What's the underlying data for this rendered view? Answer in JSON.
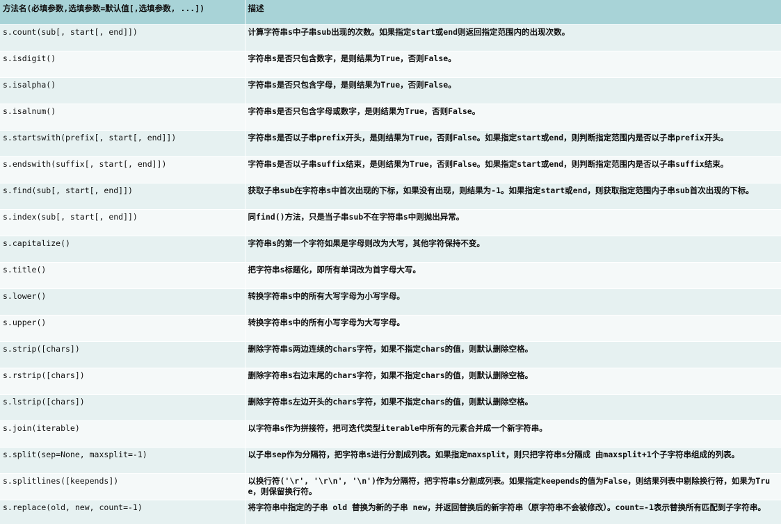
{
  "table": {
    "headers": {
      "method": "方法名(必填参数,选填参数=默认值[,选填参数, ...])",
      "description": "描述"
    },
    "rows": [
      {
        "method": "s.count(sub[, start[, end]])",
        "description": "计算字符串s中子串sub出现的次数。如果指定start或end则返回指定范围内的出现次数。"
      },
      {
        "method": "s.isdigit()",
        "description": "字符串s是否只包含数字，是则结果为True，否则False。"
      },
      {
        "method": "s.isalpha()",
        "description": "字符串s是否只包含字母，是则结果为True，否则False。"
      },
      {
        "method": "s.isalnum()",
        "description": "字符串s是否只包含字母或数字，是则结果为True，否则False。"
      },
      {
        "method": "s.startswith(prefix[, start[, end]])",
        "description": "字符串s是否以子串prefix开头，是则结果为True，否则False。如果指定start或end，则判断指定范围内是否以子串prefix开头。"
      },
      {
        "method": "s.endswith(suffix[, start[, end]])",
        "description": "字符串s是否以子串suffix结束，是则结果为True，否则False。如果指定start或end，则判断指定范围内是否以子串suffix结束。"
      },
      {
        "method": "s.find(sub[, start[, end]])",
        "description": "获取子串sub在字符串s中首次出现的下标，如果没有出现，则结果为-1。如果指定start或end，则获取指定范围内子串sub首次出现的下标。"
      },
      {
        "method": "s.index(sub[, start[, end]])",
        "description": "同find()方法，只是当子串sub不在字符串s中则抛出异常。"
      },
      {
        "method": "s.capitalize()",
        "description": "字符串s的第一个字符如果是字母则改为大写，其他字符保持不变。"
      },
      {
        "method": "s.title()",
        "description": "把字符串s标题化，即所有单词改为首字母大写。"
      },
      {
        "method": "s.lower()",
        "description": "转换字符串s中的所有大写字母为小写字母。"
      },
      {
        "method": "s.upper()",
        "description": "转换字符串s中的所有小写字母为大写字母。"
      },
      {
        "method": "s.strip([chars])",
        "description": "删除字符串s两边连续的chars字符，如果不指定chars的值，则默认删除空格。"
      },
      {
        "method": "s.rstrip([chars])",
        "description": "删除字符串s右边末尾的chars字符，如果不指定chars的值，则默认删除空格。"
      },
      {
        "method": "s.lstrip([chars])",
        "description": "删除字符串s左边开头的chars字符，如果不指定chars的值，则默认删除空格。"
      },
      {
        "method": "s.join(iterable)",
        "description": "以字符串s作为拼接符，把可迭代类型iterable中所有的元素合并成一个新字符串。"
      },
      {
        "method": "s.split(sep=None, maxsplit=-1)",
        "description": "以子串sep作为分隔符，把字符串s进行分割成列表。如果指定maxsplit，则只把字符串s分隔成 由maxsplit+1个子字符串组成的列表。"
      },
      {
        "method": "s.splitlines([keepends])",
        "description": "以换行符('\\r', '\\r\\n', '\\n')作为分隔符，把字符串s分割成列表。如果指定keepends的值为False，则结果列表中剔除换行符，如果为True，则保留换行符。"
      },
      {
        "method": "s.replace(old, new, count=-1)",
        "description": "将字符串中指定的子串 old 替换为新的子串 new，并返回替换后的新字符串（原字符串不会被修改）。count=-1表示替换所有匹配到子字符串。"
      }
    ]
  },
  "colors": {
    "header_bg": "#a8d3d7",
    "row_even_bg": "#e6f1f1",
    "row_odd_bg": "#f5f9f9"
  }
}
